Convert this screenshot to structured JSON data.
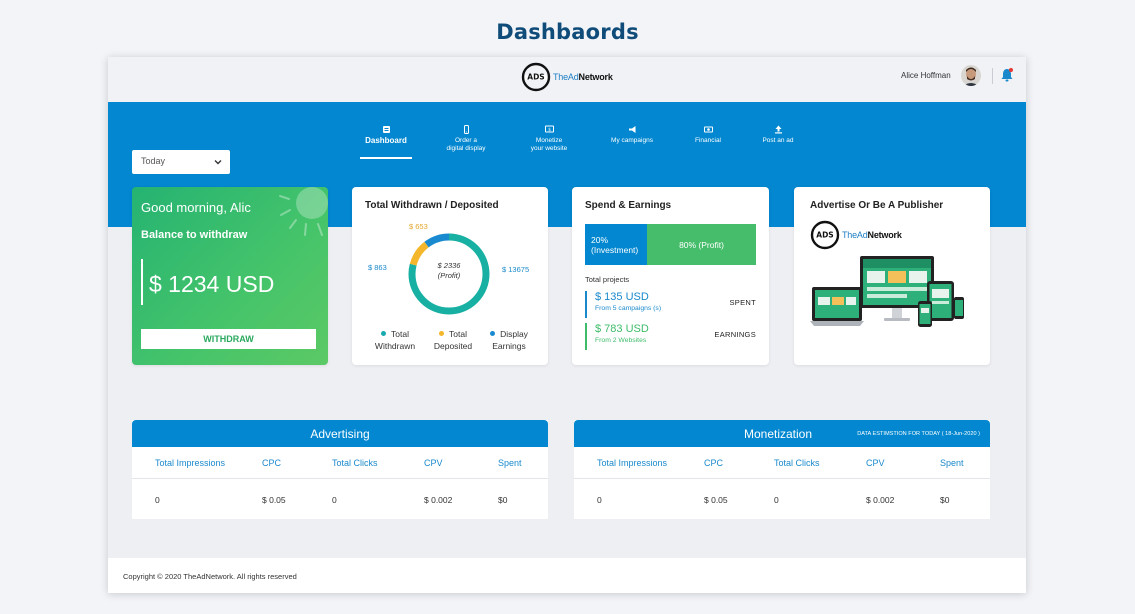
{
  "page": {
    "heading": "Dashbaords"
  },
  "header": {
    "logo_left": "TheAd",
    "logo_right": "Network",
    "user_name": "Alice Hoffman"
  },
  "nav": [
    {
      "label": "Dashboard",
      "icon": "dashboard-icon",
      "active": true
    },
    {
      "label": "Order a\ndigital display",
      "icon": "phone-icon"
    },
    {
      "label": "Monetize\nyour website",
      "icon": "monitor-dollar-icon"
    },
    {
      "label": "My campaigns",
      "icon": "megaphone-icon"
    },
    {
      "label": "Financial",
      "icon": "money-icon"
    },
    {
      "label": "Post an ad",
      "icon": "upload-icon"
    }
  ],
  "filter": {
    "selected": "Today"
  },
  "balance": {
    "greeting": "Good morning, Alic",
    "label": "Balance to withdraw",
    "amount": "$ 1234 USD",
    "button": "WITHDRAW"
  },
  "withdrawn_deposited": {
    "title": "Total Withdrawn / Deposited",
    "center_line1": "$ 2336",
    "center_line2": "(Profit)",
    "label_top": "$ 653",
    "label_left": "$ 863",
    "label_right": "$ 13675",
    "legend": [
      {
        "line1": "Total",
        "line2": "Withdrawn",
        "color": "#18aab0"
      },
      {
        "line1": "Total",
        "line2": "Deposited",
        "color": "#f4b62b"
      },
      {
        "line1": "Display",
        "line2": "Earnings",
        "color": "#1a8ad0"
      }
    ],
    "segments": [
      {
        "name": "withdrawn",
        "value": 13675,
        "color": "#18b0a2"
      },
      {
        "name": "deposited",
        "value": 653,
        "color": "#f4b62b"
      },
      {
        "name": "earnings",
        "value": 863,
        "color": "#1a8ad0"
      }
    ]
  },
  "spend": {
    "title": "Spend & Earnings",
    "investment_pct": "20%",
    "investment_label": "(Investment)",
    "profit_label": "80% (Profit)",
    "total_projects": "Total projects",
    "spent_amount": "$ 135 USD",
    "spent_sub": "From 5 campaigns (s)",
    "spent_tag": "SPENT",
    "earn_amount": "$ 783 USD",
    "earn_sub": "From 2 Websites",
    "earn_tag": "EARNINGS",
    "colors": {
      "spent": "#1a89cc",
      "earn": "#3fbc6a"
    }
  },
  "advertise": {
    "title": "Advertise Or Be A Publisher",
    "logo_left": "TheAd",
    "logo_right": "Network"
  },
  "advertising": {
    "title": "Advertising",
    "columns": [
      "Total Impressions",
      "CPC",
      "Total Clicks",
      "CPV",
      "Spent"
    ],
    "row": [
      "0",
      "$ 0.05",
      "0",
      "$ 0.002",
      "$0"
    ]
  },
  "monetization": {
    "title": "Monetization",
    "note": "DATA ESTIMSTION FOR TODAY ( 18-Jun-2020 )",
    "columns": [
      "Total Impressions",
      "CPC",
      "Total Clicks",
      "CPV",
      "Spent"
    ],
    "row": [
      "0",
      "$ 0.05",
      "0",
      "$ 0.002",
      "$0"
    ]
  },
  "footer": {
    "copyright": "Copyright © 2020 TheAdNetwork. All rights reserved"
  }
}
